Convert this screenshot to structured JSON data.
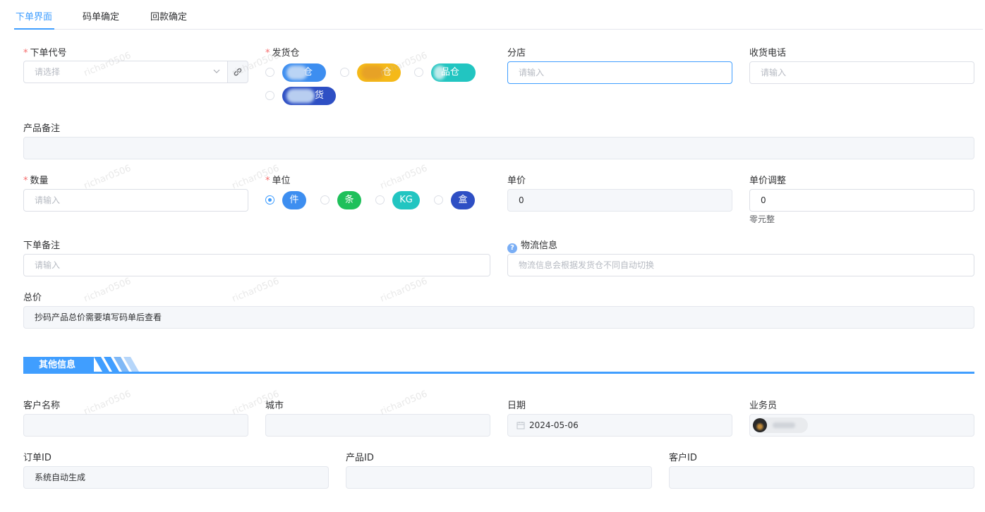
{
  "tabs": [
    {
      "label": "下单界面",
      "active": true
    },
    {
      "label": "码单确定",
      "active": false
    },
    {
      "label": "回款确定",
      "active": false
    }
  ],
  "form": {
    "order_code": {
      "label": "下单代号",
      "placeholder": "请选择",
      "required": true
    },
    "warehouse": {
      "label": "发货仓",
      "required": true,
      "options": [
        {
          "label": "仓",
          "color": "#3d8ef0"
        },
        {
          "label": "仓",
          "color": "#f5b919"
        },
        {
          "label": "品仓",
          "color": "#22c5c1"
        },
        {
          "label": "货",
          "color": "#2e4fc4"
        }
      ]
    },
    "branch": {
      "label": "分店",
      "placeholder": "请输入"
    },
    "phone": {
      "label": "收货电话",
      "placeholder": "请输入"
    },
    "product_note": {
      "label": "产品备注",
      "value": ""
    },
    "quantity": {
      "label": "数量",
      "placeholder": "请输入",
      "required": true
    },
    "unit": {
      "label": "单位",
      "required": true,
      "selected": "件",
      "options": [
        {
          "label": "件",
          "color": "#3d8ef0"
        },
        {
          "label": "条",
          "color": "#1ec05a"
        },
        {
          "label": "KG",
          "color": "#22c5c1"
        },
        {
          "label": "盒",
          "color": "#2e4fc4"
        }
      ]
    },
    "unit_price": {
      "label": "单价",
      "value": "0"
    },
    "price_adjust": {
      "label": "单价调整",
      "value": "0",
      "hint": "零元整"
    },
    "order_note": {
      "label": "下单备注",
      "placeholder": "请输入"
    },
    "logistics": {
      "label": "物流信息",
      "placeholder": "物流信息会根据发货仓不同自动切换"
    },
    "total": {
      "label": "总价",
      "value": "抄码产品总价需要填写码单后查看"
    }
  },
  "other_section": {
    "title": "其他信息"
  },
  "other": {
    "customer_name": {
      "label": "客户名称",
      "value": ""
    },
    "city": {
      "label": "城市",
      "value": ""
    },
    "date": {
      "label": "日期",
      "value": "2024-05-06"
    },
    "salesperson": {
      "label": "业务员"
    },
    "order_id": {
      "label": "订单ID",
      "value": "系统自动生成"
    },
    "product_id": {
      "label": "产品ID",
      "value": ""
    },
    "customer_id": {
      "label": "客户ID",
      "value": ""
    }
  },
  "watermark_text": "richar0506",
  "accent_color": "#409eff"
}
